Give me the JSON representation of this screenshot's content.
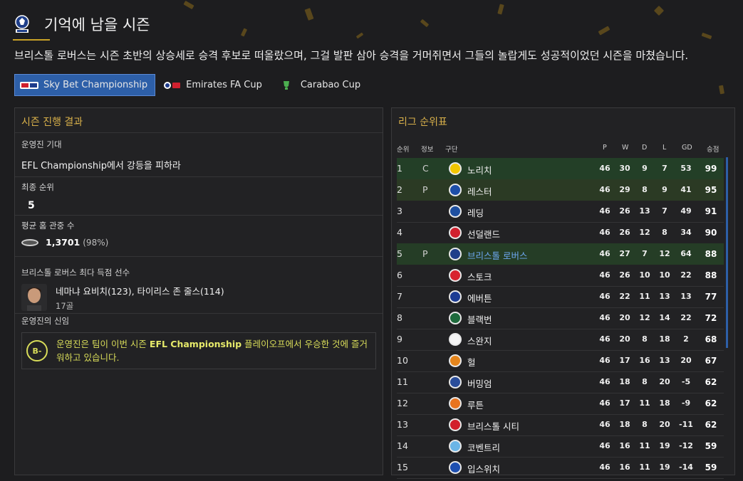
{
  "page": {
    "title": "기억에 남을 시즌",
    "subtitle": "브리스톨 로버스는 시즌 초반의 상승세로 승격 후보로 떠올랐으며, 그걸 발판 삼아 승격을 거머쥐면서 그들의 놀랍게도 성공적이었던 시즌을 마쳤습니다."
  },
  "tabs": [
    {
      "label": "Sky Bet Championship",
      "active": true,
      "icon": "sky-bet-logo"
    },
    {
      "label": "Emirates FA Cup",
      "active": false,
      "icon": "fa-cup-logo"
    },
    {
      "label": "Carabao Cup",
      "active": false,
      "icon": "carabao-cup-logo"
    }
  ],
  "left_panel": {
    "title": "시즌 진행 결과",
    "expectation_label": "운영진 기대",
    "expectation_value": "EFL Championship에서 강등을 피하라",
    "final_position_label": "최종 순위",
    "final_position_value": "5",
    "attendance_label": "평균 홈 관중 수",
    "attendance_value": "1,3701",
    "attendance_pct": "(98%)",
    "top_scorer_label": "브리스톨 로버스 최다 득점 선수",
    "top_scorer_names": "네마냐 요비치(123), 타이리스 존 줄스(114)",
    "top_scorer_goals": "17골",
    "board_confidence_label": "운영진의 신임",
    "grade": "B-",
    "verdict_pre": "운영진은 팀이 이번 시즌 ",
    "verdict_bold": "EFL Championship",
    "verdict_post": " 플레이오프에서 우승한 것에 즐거워하고 있습니다."
  },
  "right_panel": {
    "title": "리그 순위표",
    "headers": {
      "pos": "순위",
      "info": "정보",
      "team": "구단",
      "p": "P",
      "w": "W",
      "d": "D",
      "l": "L",
      "gd": "GD",
      "pts": "승점"
    }
  },
  "table": [
    {
      "pos": "1",
      "info": "C",
      "team": "노리치",
      "p": "46",
      "w": "30",
      "d": "9",
      "l": "7",
      "gd": "53",
      "pts": "99",
      "status": "promo",
      "badge": "#f2c600"
    },
    {
      "pos": "2",
      "info": "P",
      "team": "레스터",
      "p": "46",
      "w": "29",
      "d": "8",
      "l": "9",
      "gd": "41",
      "pts": "95",
      "status": "playoff",
      "badge": "#1d4ea8"
    },
    {
      "pos": "3",
      "info": "",
      "team": "레딩",
      "p": "46",
      "w": "26",
      "d": "13",
      "l": "7",
      "gd": "49",
      "pts": "91",
      "status": "",
      "badge": "#1e4fa0"
    },
    {
      "pos": "4",
      "info": "",
      "team": "선덜랜드",
      "p": "46",
      "w": "26",
      "d": "12",
      "l": "8",
      "gd": "34",
      "pts": "90",
      "status": "",
      "badge": "#d0202e"
    },
    {
      "pos": "5",
      "info": "P",
      "team": "브리스톨 로버스",
      "p": "46",
      "w": "27",
      "d": "7",
      "l": "12",
      "gd": "64",
      "pts": "88",
      "status": "own",
      "badge": "#1f3f8a"
    },
    {
      "pos": "6",
      "info": "",
      "team": "스토크",
      "p": "46",
      "w": "26",
      "d": "10",
      "l": "10",
      "gd": "22",
      "pts": "88",
      "status": "",
      "badge": "#d8232e"
    },
    {
      "pos": "7",
      "info": "",
      "team": "에버튼",
      "p": "46",
      "w": "22",
      "d": "11",
      "l": "13",
      "gd": "13",
      "pts": "77",
      "status": "",
      "badge": "#1c3c94"
    },
    {
      "pos": "8",
      "info": "",
      "team": "블랙번",
      "p": "46",
      "w": "20",
      "d": "12",
      "l": "14",
      "gd": "22",
      "pts": "72",
      "status": "",
      "badge": "#1e6a3c"
    },
    {
      "pos": "9",
      "info": "",
      "team": "스완지",
      "p": "46",
      "w": "20",
      "d": "8",
      "l": "18",
      "gd": "2",
      "pts": "68",
      "status": "",
      "badge": "#f4f4f4"
    },
    {
      "pos": "10",
      "info": "",
      "team": "헐",
      "p": "46",
      "w": "17",
      "d": "16",
      "l": "13",
      "gd": "20",
      "pts": "67",
      "status": "",
      "badge": "#e5851c"
    },
    {
      "pos": "11",
      "info": "",
      "team": "버밍엄",
      "p": "46",
      "w": "18",
      "d": "8",
      "l": "20",
      "gd": "-5",
      "pts": "62",
      "status": "",
      "badge": "#2a4d9a"
    },
    {
      "pos": "12",
      "info": "",
      "team": "루튼",
      "p": "46",
      "w": "17",
      "d": "11",
      "l": "18",
      "gd": "-9",
      "pts": "62",
      "status": "",
      "badge": "#e9741f"
    },
    {
      "pos": "13",
      "info": "",
      "team": "브리스톨 시티",
      "p": "46",
      "w": "18",
      "d": "8",
      "l": "20",
      "gd": "-11",
      "pts": "62",
      "status": "",
      "badge": "#d21e2b"
    },
    {
      "pos": "14",
      "info": "",
      "team": "코벤트리",
      "p": "46",
      "w": "16",
      "d": "11",
      "l": "19",
      "gd": "-12",
      "pts": "59",
      "status": "",
      "badge": "#6bb5e6"
    },
    {
      "pos": "15",
      "info": "",
      "team": "입스위치",
      "p": "46",
      "w": "16",
      "d": "11",
      "l": "19",
      "gd": "-14",
      "pts": "59",
      "status": "",
      "badge": "#1e4fb0"
    }
  ]
}
